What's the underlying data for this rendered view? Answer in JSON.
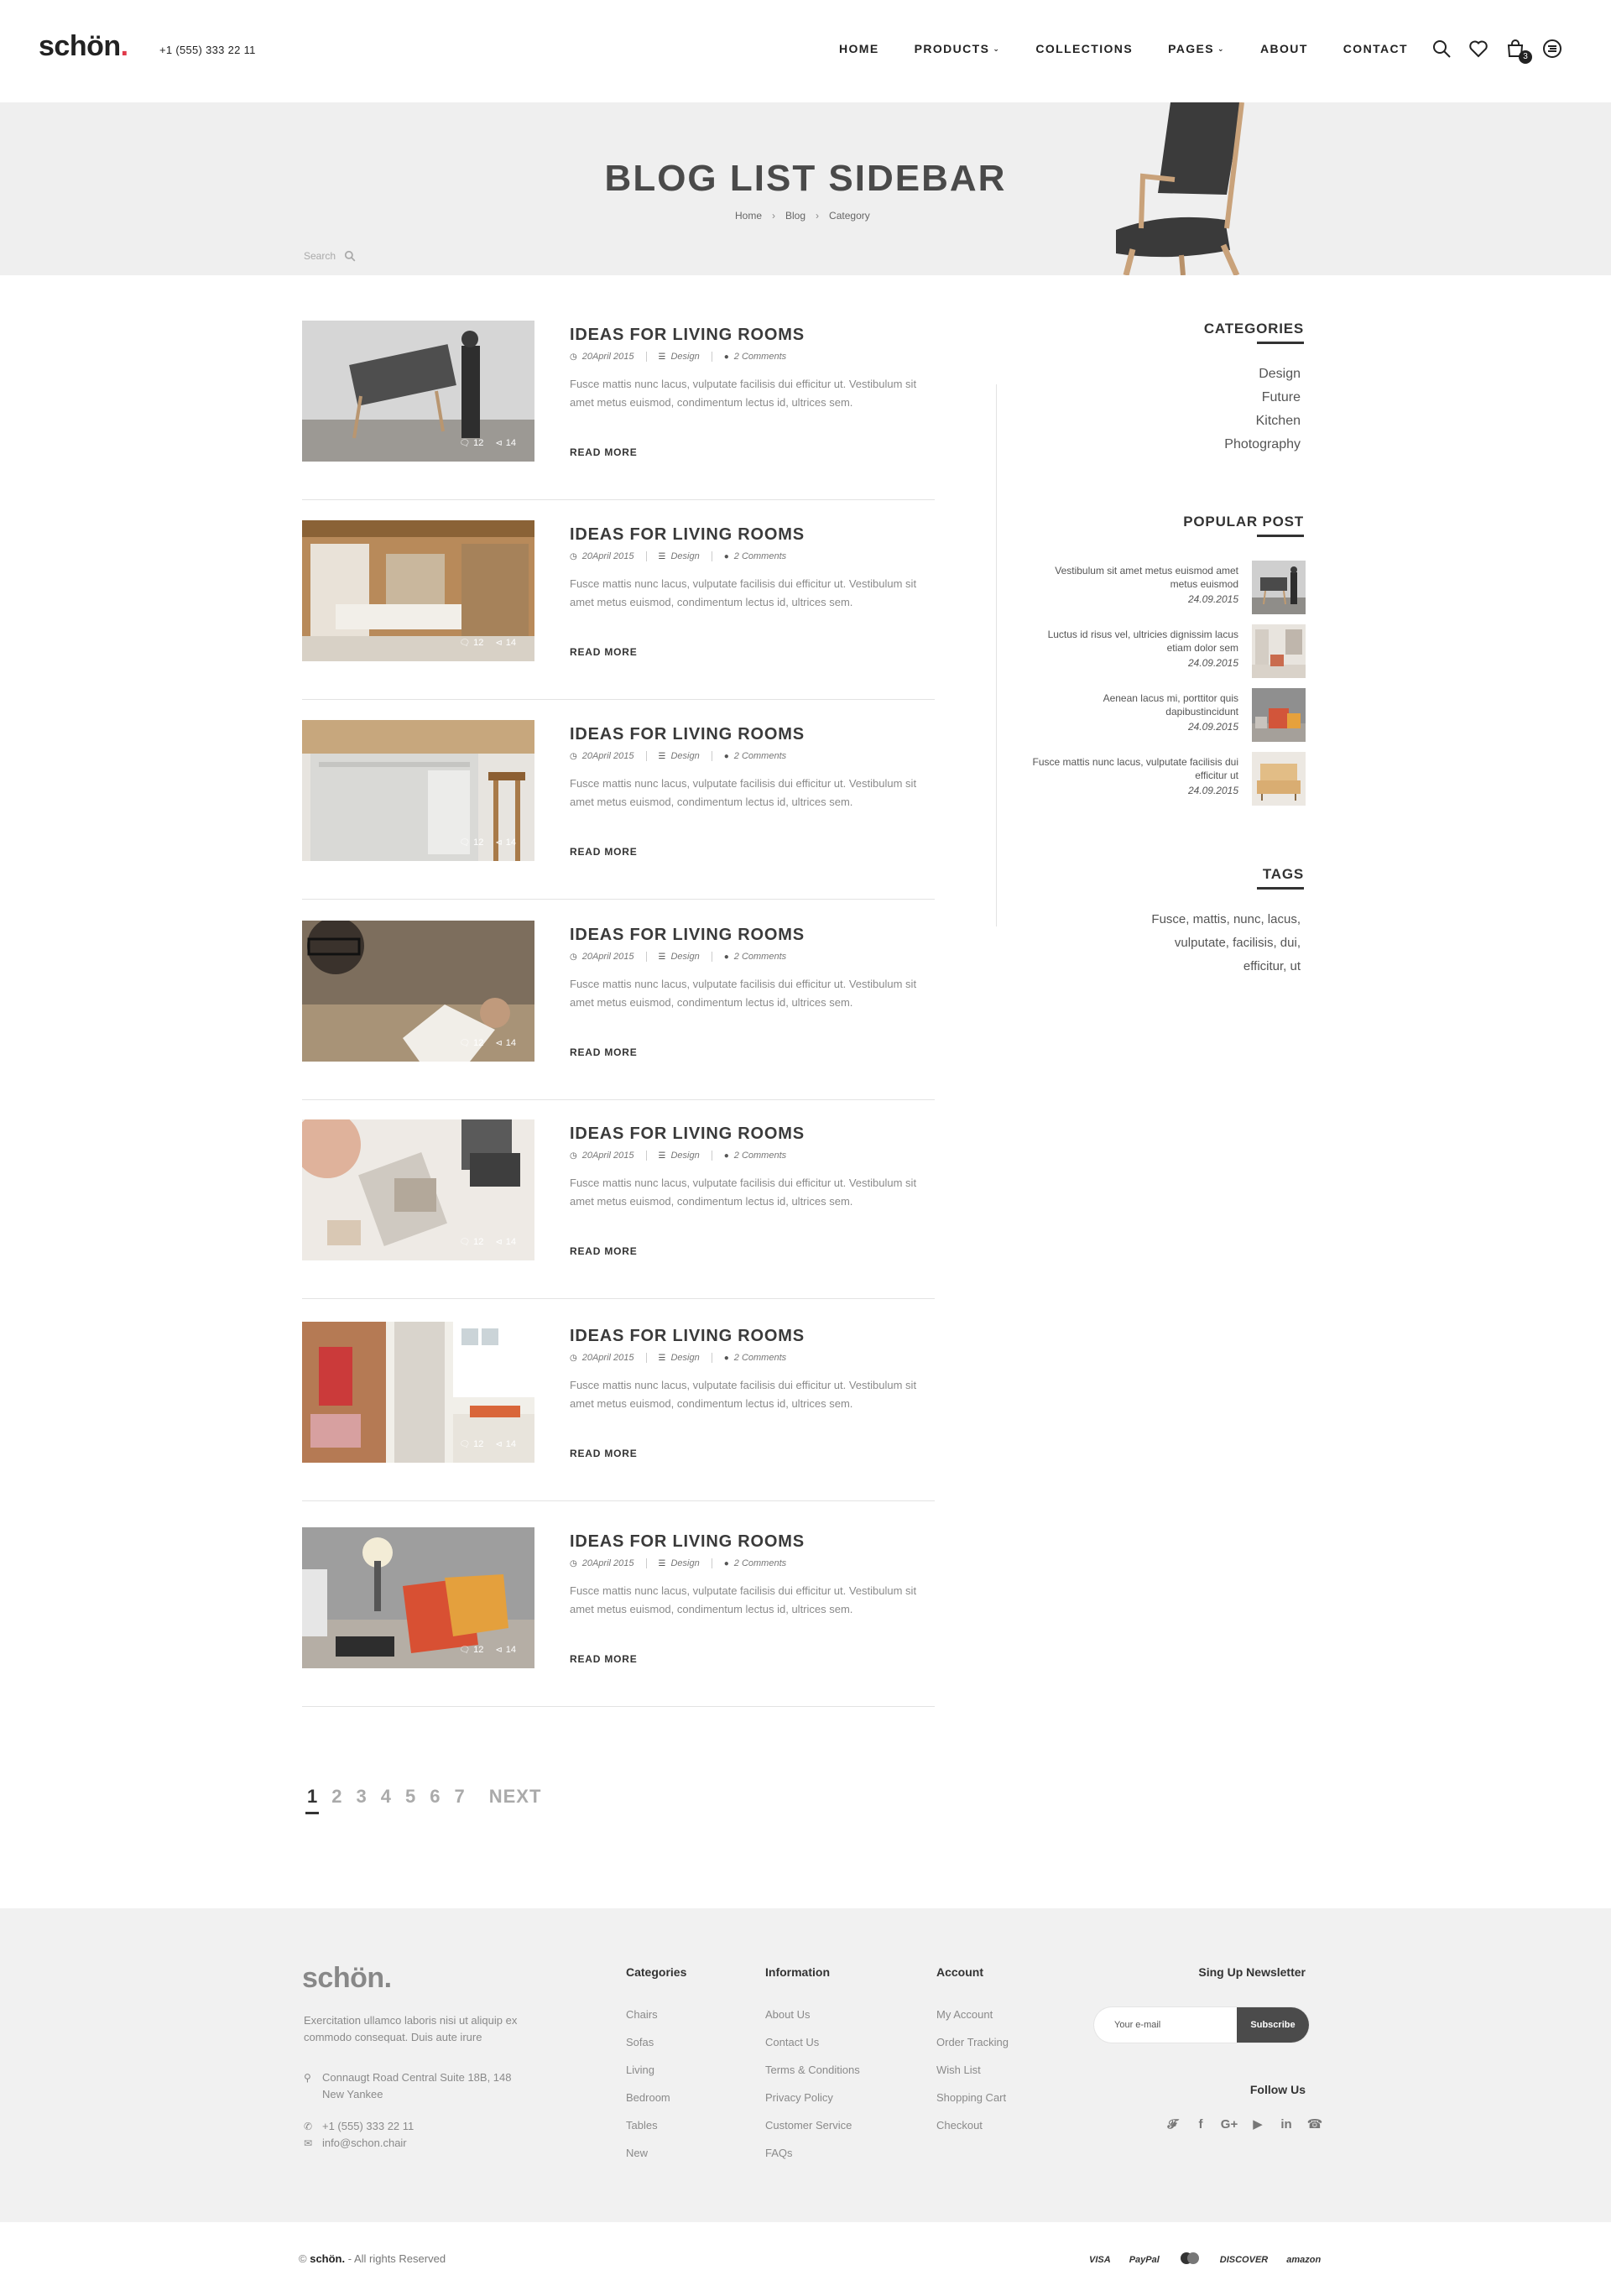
{
  "header": {
    "logo_text": "schön",
    "logo_dot": ".",
    "phone": "+1 (555) 333 22 11",
    "nav": [
      {
        "label": "HOME",
        "dropdown": false
      },
      {
        "label": "PRODUCTS",
        "dropdown": true
      },
      {
        "label": "COLLECTIONS",
        "dropdown": false
      },
      {
        "label": "PAGES",
        "dropdown": true
      },
      {
        "label": "ABOUT",
        "dropdown": false
      },
      {
        "label": "CONTACT",
        "dropdown": false
      }
    ],
    "icons": [
      "search-icon",
      "heart-icon",
      "cart-icon",
      "menu-icon"
    ],
    "cart_count": "3"
  },
  "hero": {
    "title": "BLOG LIST SIDEBAR",
    "breadcrumb": [
      "Home",
      "Blog",
      "Category"
    ],
    "search_placeholder": "Search"
  },
  "posts": [
    {
      "title": "IDEAS FOR LIVING ROOMS",
      "date": "20April 2015",
      "category": "Design",
      "comments": "2 Comments",
      "excerpt": "Fusce mattis nunc lacus, vulputate facilisis dui efficitur ut. Vestibulum sit amet metus euismod, condimentum lectus id, ultrices sem.",
      "read_more": "READ MORE",
      "likes": "12",
      "shares": "14"
    },
    {
      "title": "IDEAS FOR LIVING ROOMS",
      "date": "20April 2015",
      "category": "Design",
      "comments": "2 Comments",
      "excerpt": "Fusce mattis nunc lacus, vulputate facilisis dui efficitur ut. Vestibulum sit amet metus euismod, condimentum lectus id, ultrices sem.",
      "read_more": "READ MORE",
      "likes": "12",
      "shares": "14"
    },
    {
      "title": "IDEAS FOR LIVING ROOMS",
      "date": "20April 2015",
      "category": "Design",
      "comments": "2 Comments",
      "excerpt": "Fusce mattis nunc lacus, vulputate facilisis dui efficitur ut. Vestibulum sit amet metus euismod, condimentum lectus id, ultrices sem.",
      "read_more": "READ MORE",
      "likes": "12",
      "shares": "14"
    },
    {
      "title": "IDEAS FOR LIVING ROOMS",
      "date": "20April 2015",
      "category": "Design",
      "comments": "2 Comments",
      "excerpt": "Fusce mattis nunc lacus, vulputate facilisis dui efficitur ut. Vestibulum sit amet metus euismod, condimentum lectus id, ultrices sem.",
      "read_more": "READ MORE",
      "likes": "12",
      "shares": "14"
    },
    {
      "title": "IDEAS FOR LIVING ROOMS",
      "date": "20April 2015",
      "category": "Design",
      "comments": "2 Comments",
      "excerpt": "Fusce mattis nunc lacus, vulputate facilisis dui efficitur ut. Vestibulum sit amet metus euismod, condimentum lectus id, ultrices sem.",
      "read_more": "READ MORE",
      "likes": "12",
      "shares": "14"
    },
    {
      "title": "IDEAS FOR LIVING ROOMS",
      "date": "20April 2015",
      "category": "Design",
      "comments": "2 Comments",
      "excerpt": "Fusce mattis nunc lacus, vulputate facilisis dui efficitur ut. Vestibulum sit amet metus euismod, condimentum lectus id, ultrices sem.",
      "read_more": "READ MORE",
      "likes": "12",
      "shares": "14"
    },
    {
      "title": "IDEAS FOR LIVING ROOMS",
      "date": "20April 2015",
      "category": "Design",
      "comments": "2 Comments",
      "excerpt": "Fusce mattis nunc lacus, vulputate facilisis dui efficitur ut. Vestibulum sit amet metus euismod, condimentum lectus id, ultrices sem.",
      "read_more": "READ MORE",
      "likes": "12",
      "shares": "14"
    }
  ],
  "sidebar": {
    "categories_title": "CATEGORIES",
    "categories": [
      "Design",
      "Future",
      "Kitchen",
      "Photography"
    ],
    "popular_title": "POPULAR POST",
    "popular": [
      {
        "text": "Vestibulum sit amet metus euismod amet metus euismod",
        "date": "24.09.2015"
      },
      {
        "text": "Luctus id risus vel, ultricies dignissim lacus etiam dolor sem",
        "date": "24.09.2015"
      },
      {
        "text": "Aenean lacus mi, porttitor quis dapibustincidunt",
        "date": "24.09.2015"
      },
      {
        "text": "Fusce mattis nunc lacus, vulputate facilisis dui efficitur ut",
        "date": "24.09.2015"
      }
    ],
    "tags_title": "TAGS",
    "tags": "Fusce, mattis, nunc, lacus, vulputate, facilisis, dui, efficitur, ut"
  },
  "pagination": {
    "pages": [
      "1",
      "2",
      "3",
      "4",
      "5",
      "6",
      "7"
    ],
    "active": "1",
    "next": "NEXT"
  },
  "footer": {
    "logo": "schön.",
    "description": "Exercitation ullamco laboris nisi ut aliquip ex commodo consequat. Duis aute irure",
    "address_line1": "Connaugt Road Central Suite 18B, 148",
    "address_line2": "New Yankee",
    "phone": "+1 (555) 333 22 11",
    "email": "info@schon.chair",
    "columns": [
      {
        "title": "Categories",
        "links": [
          "Chairs",
          "Sofas",
          "Living",
          "Bedroom",
          "Tables",
          "New"
        ]
      },
      {
        "title": "Information",
        "links": [
          "About Us",
          "Contact Us",
          "Terms & Conditions",
          "Privacy Policy",
          "Customer Service",
          "FAQs"
        ]
      },
      {
        "title": "Account",
        "links": [
          "My Account",
          "Order Tracking",
          "Wish List",
          "Shopping Cart",
          "Checkout"
        ]
      }
    ],
    "newsletter_title": "Sing Up Newsletter",
    "newsletter_placeholder": "Your e-mail",
    "subscribe_label": "Subscribe",
    "follow_title": "Follow Us",
    "social": [
      "twitter-icon",
      "facebook-icon",
      "google-plus-icon",
      "youtube-icon",
      "linkedin-icon",
      "whatsapp-icon"
    ],
    "copyright_brand": "schön.",
    "copyright_prefix": "©",
    "copyright_text": " - All rights Reserved",
    "payments": [
      "VISA",
      "PayPal",
      "MasterCard",
      "DISCOVER",
      "amazon"
    ]
  }
}
